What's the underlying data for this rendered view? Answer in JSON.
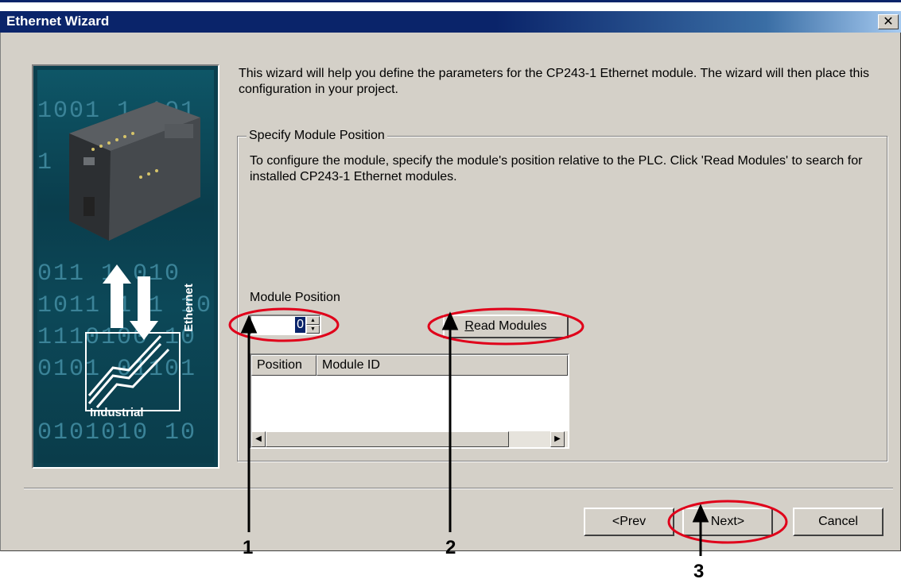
{
  "window": {
    "title": "Ethernet Wizard",
    "close_glyph": "✕"
  },
  "image_panel": {
    "binary_rows": [
      "1001 1 101",
      "1 1 1 1 01",
      "011 1 010",
      "1011 1 1 10",
      "1110100 10",
      "0101 01101",
      "0101010 10"
    ],
    "brand_industrial": "Industrial",
    "brand_ethernet": "Ethernet"
  },
  "intro": {
    "text": "This wizard will help you define the parameters for the CP243-1 Ethernet module. The wizard will then place this configuration in your project."
  },
  "group": {
    "title": "Specify Module Position",
    "description": "To configure the module, specify the module's position relative to the PLC. Click 'Read Modules' to search for installed CP243-1 Ethernet modules."
  },
  "module_position": {
    "label": "Module Position",
    "value": "0"
  },
  "buttons": {
    "read_modules": "Read Modules",
    "read_modules_mnemonic": "R",
    "read_modules_rest": "ead Modules",
    "prev": "<Prev",
    "next": "Next>",
    "cancel": "Cancel"
  },
  "list": {
    "columns": [
      "Position",
      "Module ID"
    ],
    "rows": []
  },
  "annotations": {
    "callouts": [
      "1",
      "2",
      "3"
    ],
    "highlight_color": "#e0001a"
  },
  "colors": {
    "titlebar": "#0a246a",
    "dialog_face": "#d4d0c8",
    "selection": "#0a246a"
  }
}
